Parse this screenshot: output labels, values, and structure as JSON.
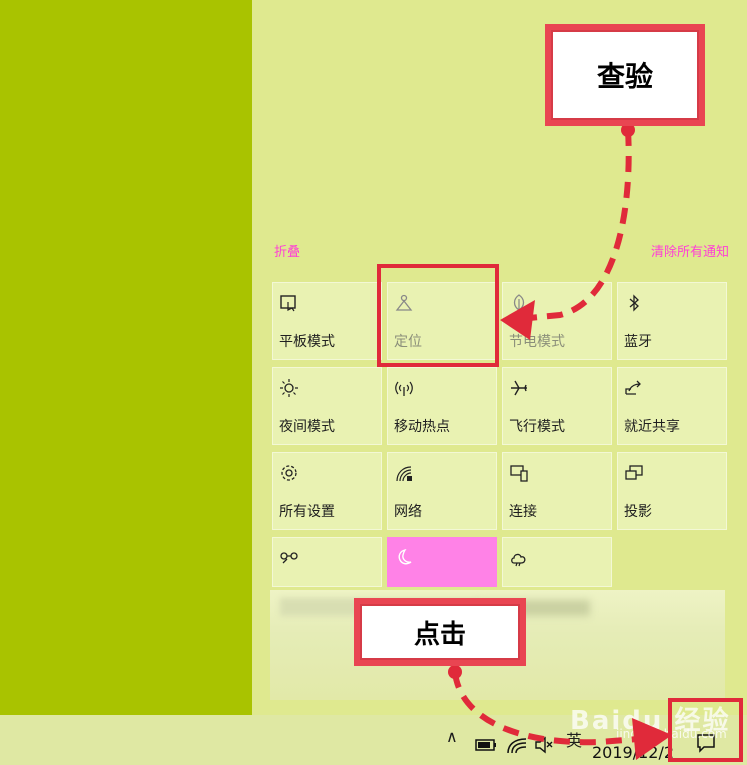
{
  "action_center": {
    "collapse_label": "折叠",
    "clear_all_label": "清除所有通知",
    "tiles": [
      {
        "label": "平板模式",
        "icon": "tablet-mode-icon"
      },
      {
        "label": "定位",
        "icon": "location-icon"
      },
      {
        "label": "节电模式",
        "icon": "battery-saver-icon"
      },
      {
        "label": "蓝牙",
        "icon": "bluetooth-icon"
      },
      {
        "label": "夜间模式",
        "icon": "night-light-icon"
      },
      {
        "label": "移动热点",
        "icon": "mobile-hotspot-icon"
      },
      {
        "label": "飞行模式",
        "icon": "airplane-mode-icon"
      },
      {
        "label": "就近共享",
        "icon": "nearby-sharing-icon"
      },
      {
        "label": "所有设置",
        "icon": "settings-icon"
      },
      {
        "label": "网络",
        "icon": "network-icon"
      },
      {
        "label": "连接",
        "icon": "connect-icon"
      },
      {
        "label": "投影",
        "icon": "project-icon"
      },
      {
        "label": "",
        "icon": "vpn-icon"
      },
      {
        "label": "",
        "icon": "focus-assist-moon-icon"
      },
      {
        "label": "",
        "icon": "weather-icon"
      }
    ]
  },
  "callouts": {
    "check": "查验",
    "click": "点击"
  },
  "taskbar": {
    "ime": "英",
    "datetime": "2019/12/2"
  },
  "watermark": {
    "text": "Baidu 经验",
    "sub": "jingyan.baidu.com"
  },
  "colors": {
    "desktop": "#a9c300",
    "panel": "#dfe98f",
    "tile": "#e9f2b2",
    "accent_pink": "#ff82e7",
    "link_pink": "#ff3fd6",
    "annotation_red": "#e94552"
  }
}
